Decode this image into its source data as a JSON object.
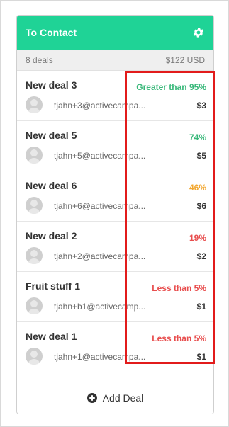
{
  "column": {
    "title": "To Contact",
    "settings_icon": "gear-icon",
    "summary": {
      "count": "8 deals",
      "total": "$122 USD"
    }
  },
  "deals": [
    {
      "title": "New deal 3",
      "probability": "Greater than 95%",
      "probability_color": "#39b87a",
      "email": "tjahn+3@activecampa...",
      "value": "$3"
    },
    {
      "title": "New deal 5",
      "probability": "74%",
      "probability_color": "#39b87a",
      "email": "tjahn+5@activecampa...",
      "value": "$5"
    },
    {
      "title": "New deal 6",
      "probability": "46%",
      "probability_color": "#f2a730",
      "email": "tjahn+6@activecampa...",
      "value": "$6"
    },
    {
      "title": "New deal 2",
      "probability": "19%",
      "probability_color": "#e84e4e",
      "email": "tjahn+2@activecampa...",
      "value": "$2"
    },
    {
      "title": "Fruit stuff 1",
      "probability": "Less than 5%",
      "probability_color": "#e84e4e",
      "email": "tjahn+b1@activecamp...",
      "value": "$1"
    },
    {
      "title": "New deal 1",
      "probability": "Less than 5%",
      "probability_color": "#e84e4e",
      "email": "tjahn+1@activecampa...",
      "value": "$1"
    }
  ],
  "footer": {
    "add_label": "Add Deal",
    "add_icon": "plus-circle-icon"
  },
  "colors": {
    "header": "#1fd396",
    "highlight": "#e21b1b"
  }
}
